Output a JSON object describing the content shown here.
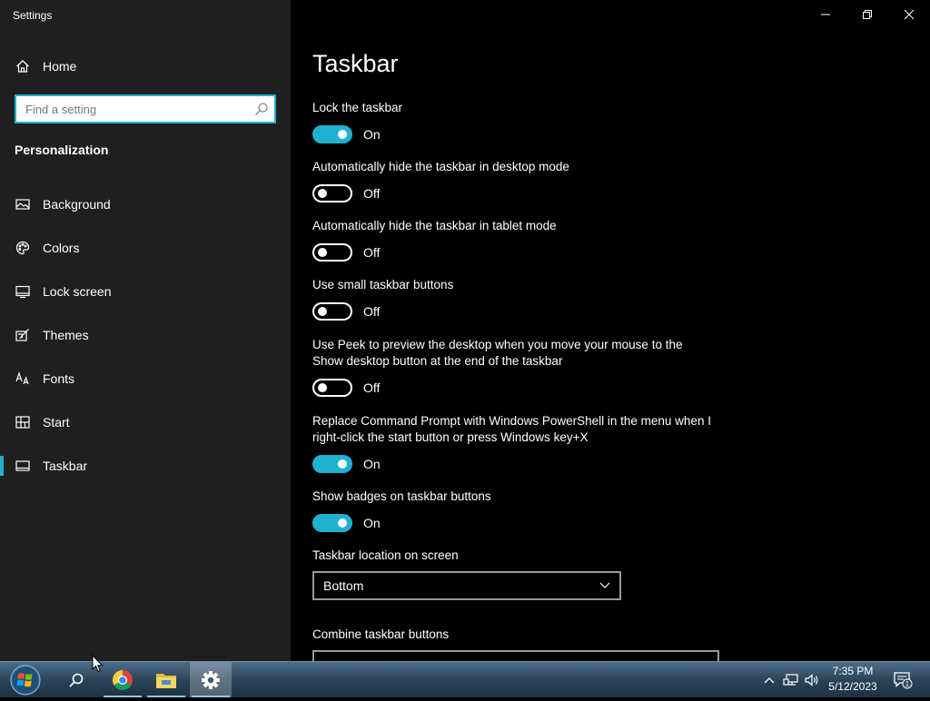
{
  "window": {
    "title": "Settings"
  },
  "sidebar": {
    "home_label": "Home",
    "search_placeholder": "Find a setting",
    "section_title": "Personalization",
    "items": [
      {
        "label": "Background",
        "icon": "picture-icon"
      },
      {
        "label": "Colors",
        "icon": "palette-icon"
      },
      {
        "label": "Lock screen",
        "icon": "lock-screen-icon"
      },
      {
        "label": "Themes",
        "icon": "brush-icon"
      },
      {
        "label": "Fonts",
        "icon": "font-icon"
      },
      {
        "label": "Start",
        "icon": "start-tiles-icon"
      },
      {
        "label": "Taskbar",
        "icon": "taskbar-icon",
        "active": true
      }
    ]
  },
  "main": {
    "title": "Taskbar",
    "settings": [
      {
        "label": "Lock the taskbar",
        "state": "On"
      },
      {
        "label": "Automatically hide the taskbar in desktop mode",
        "state": "Off"
      },
      {
        "label": "Automatically hide the taskbar in tablet mode",
        "state": "Off"
      },
      {
        "label": "Use small taskbar buttons",
        "state": "Off"
      },
      {
        "label": "Use Peek to preview the desktop when you move your mouse to the Show desktop button at the end of the taskbar",
        "state": "Off"
      },
      {
        "label": "Replace Command Prompt with Windows PowerShell in the menu when I right-click the start button or press Windows key+X",
        "state": "On"
      },
      {
        "label": "Show badges on taskbar buttons",
        "state": "On"
      }
    ],
    "location_label": "Taskbar location on screen",
    "location_value": "Bottom",
    "combine_label": "Combine taskbar buttons"
  },
  "taskbar": {
    "time": "7:35 PM",
    "date": "5/12/2023",
    "notification_count": "1"
  },
  "colors": {
    "accent": "#1fb1d0",
    "sidebar_bg": "#1f1f1f",
    "main_bg": "#000000"
  }
}
